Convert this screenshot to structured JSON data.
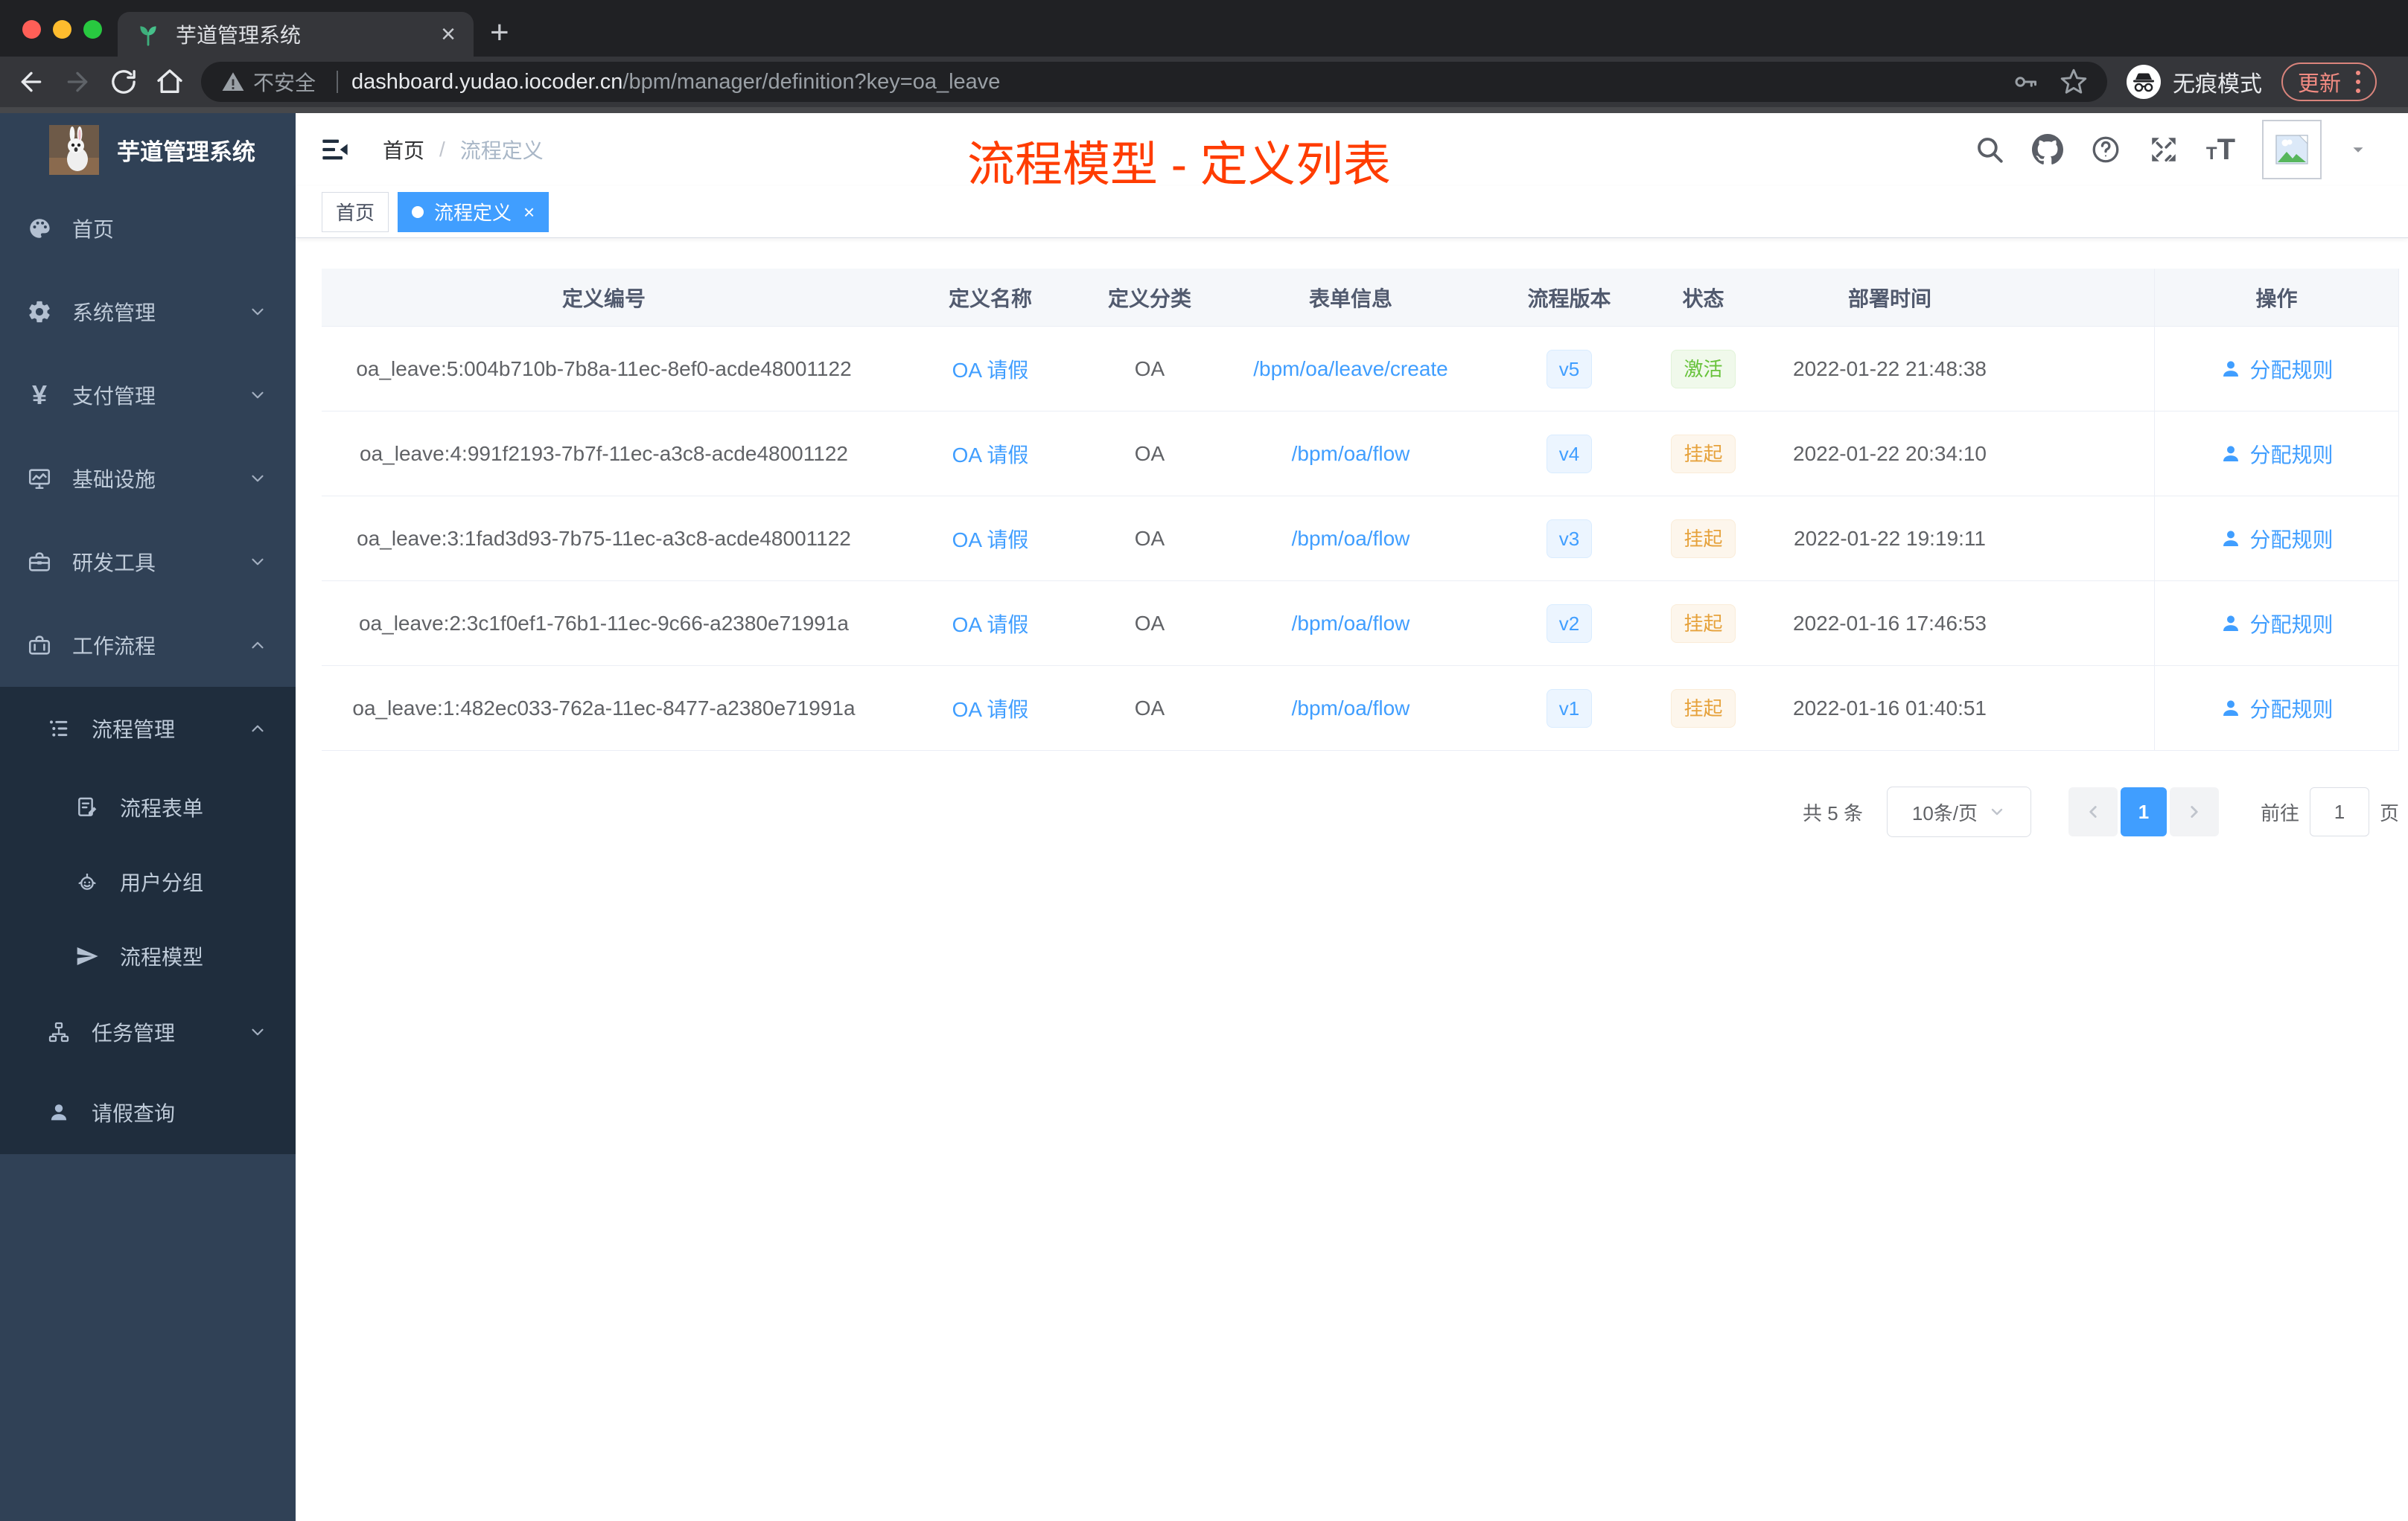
{
  "browser": {
    "tab_title": "芋道管理系统",
    "security_label": "不安全",
    "url_host": "dashboard.yudao.iocoder.cn",
    "url_path": "/bpm/manager/definition?key=oa_leave",
    "incognito_label": "无痕模式",
    "update_label": "更新"
  },
  "sidebar": {
    "logo_title": "芋道管理系统",
    "items": [
      {
        "label": "首页"
      },
      {
        "label": "系统管理"
      },
      {
        "label": "支付管理"
      },
      {
        "label": "基础设施"
      },
      {
        "label": "研发工具"
      },
      {
        "label": "工作流程"
      },
      {
        "label": "流程管理"
      },
      {
        "label": "流程表单"
      },
      {
        "label": "用户分组"
      },
      {
        "label": "流程模型"
      },
      {
        "label": "任务管理"
      },
      {
        "label": "请假查询"
      }
    ]
  },
  "header": {
    "breadcrumb": [
      "首页",
      "流程定义"
    ],
    "annotation": "流程模型 - 定义列表"
  },
  "tags_view": {
    "tabs": [
      {
        "label": "首页",
        "active": false
      },
      {
        "label": "流程定义",
        "active": true
      }
    ]
  },
  "table": {
    "columns": [
      "定义编号",
      "定义名称",
      "定义分类",
      "表单信息",
      "流程版本",
      "状态",
      "部署时间",
      "操作"
    ],
    "rows": [
      {
        "id": "oa_leave:5:004b710b-7b8a-11ec-8ef0-acde48001122",
        "name": "OA 请假",
        "category": "OA",
        "form": "/bpm/oa/leave/create",
        "version": "v5",
        "status": "激活",
        "status_type": "success",
        "deploy_time": "2022-01-22 21:48:38",
        "action": "分配规则"
      },
      {
        "id": "oa_leave:4:991f2193-7b7f-11ec-a3c8-acde48001122",
        "name": "OA 请假",
        "category": "OA",
        "form": "/bpm/oa/flow",
        "version": "v4",
        "status": "挂起",
        "status_type": "warning",
        "deploy_time": "2022-01-22 20:34:10",
        "action": "分配规则"
      },
      {
        "id": "oa_leave:3:1fad3d93-7b75-11ec-a3c8-acde48001122",
        "name": "OA 请假",
        "category": "OA",
        "form": "/bpm/oa/flow",
        "version": "v3",
        "status": "挂起",
        "status_type": "warning",
        "deploy_time": "2022-01-22 19:19:11",
        "action": "分配规则"
      },
      {
        "id": "oa_leave:2:3c1f0ef1-76b1-11ec-9c66-a2380e71991a",
        "name": "OA 请假",
        "category": "OA",
        "form": "/bpm/oa/flow",
        "version": "v2",
        "status": "挂起",
        "status_type": "warning",
        "deploy_time": "2022-01-16 17:46:53",
        "action": "分配规则"
      },
      {
        "id": "oa_leave:1:482ec033-762a-11ec-8477-a2380e71991a",
        "name": "OA 请假",
        "category": "OA",
        "form": "/bpm/oa/flow",
        "version": "v1",
        "status": "挂起",
        "status_type": "warning",
        "deploy_time": "2022-01-16 01:40:51",
        "action": "分配规则"
      }
    ]
  },
  "pagination": {
    "total_label": "共 5 条",
    "page_size_label": "10条/页",
    "current_page": "1",
    "goto_label": "前往",
    "goto_value": "1",
    "page_unit": "页"
  },
  "colors": {
    "accent": "#409eff",
    "success": "#67c23a",
    "warning": "#e6a23c",
    "annotation_red": "#ff3c00",
    "sidebar_bg": "#304156",
    "submenu_bg": "#1f2d3d"
  }
}
